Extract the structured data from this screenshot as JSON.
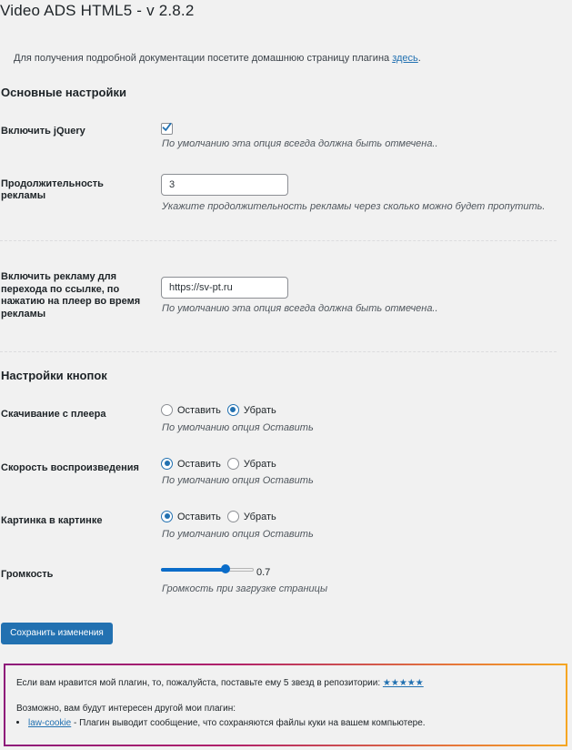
{
  "page": {
    "title": "Video ADS HTML5 - v 2.8.2",
    "intro_text": "Для получения подробной документации посетите домашнюю страницу плагина ",
    "intro_link": "здесь",
    "intro_end": "."
  },
  "sections": {
    "main_settings": "Основные настройки",
    "button_settings": "Настройки кнопок"
  },
  "fields": {
    "jquery": {
      "label": "Включить jQuery",
      "checked": true,
      "description": "По умолчанию эта опция всегда должна быть отмечена.."
    },
    "ad_duration": {
      "label": "Продолжительность рекламы",
      "value": "3",
      "description": "Укажите продолжительность рекламы через сколько можно будет пропутить."
    },
    "ad_link": {
      "label": "Включить рекламу для перехода по ссылке, по нажатию на плеер во время рекламы",
      "value": "https://sv-pt.ru",
      "description": "По умолчанию эта опция всегда должна быть отмечена.."
    },
    "download": {
      "label": "Скачивание с плеера",
      "option_keep": "Оставить",
      "option_remove": "Убрать",
      "selected": "Убрать",
      "description": "По умолчанию опция Оставить"
    },
    "speed": {
      "label": "Скорость воспроизведения",
      "option_keep": "Оставить",
      "option_remove": "Убрать",
      "selected": "Оставить",
      "description": "По умолчанию опция Оставить"
    },
    "pip": {
      "label": "Картинка в картинке",
      "option_keep": "Оставить",
      "option_remove": "Убрать",
      "selected": "Оставить",
      "description": "По умолчанию опция Оставить"
    },
    "volume": {
      "label": "Громкость",
      "value": 0.7,
      "value_text": "0.7",
      "description": "Громкость при загрузке страницы"
    }
  },
  "actions": {
    "save_label": "Сохранить изменения"
  },
  "promo": {
    "rate_text": "Если вам нравится мой плагин, то, пожалуйста, поставьте ему 5 звезд в репозитории: ",
    "rate_link": "★★★★★",
    "other_text": "Возможно, вам будут интересен другой мои плагин:",
    "plugin_link": "law-cookie",
    "plugin_desc": " - Плагин выводит сообщение, что сохраняются файлы куки на вашем компьютере."
  },
  "colors": {
    "accent": "#2271b1",
    "slider": "#0a6cc9"
  }
}
